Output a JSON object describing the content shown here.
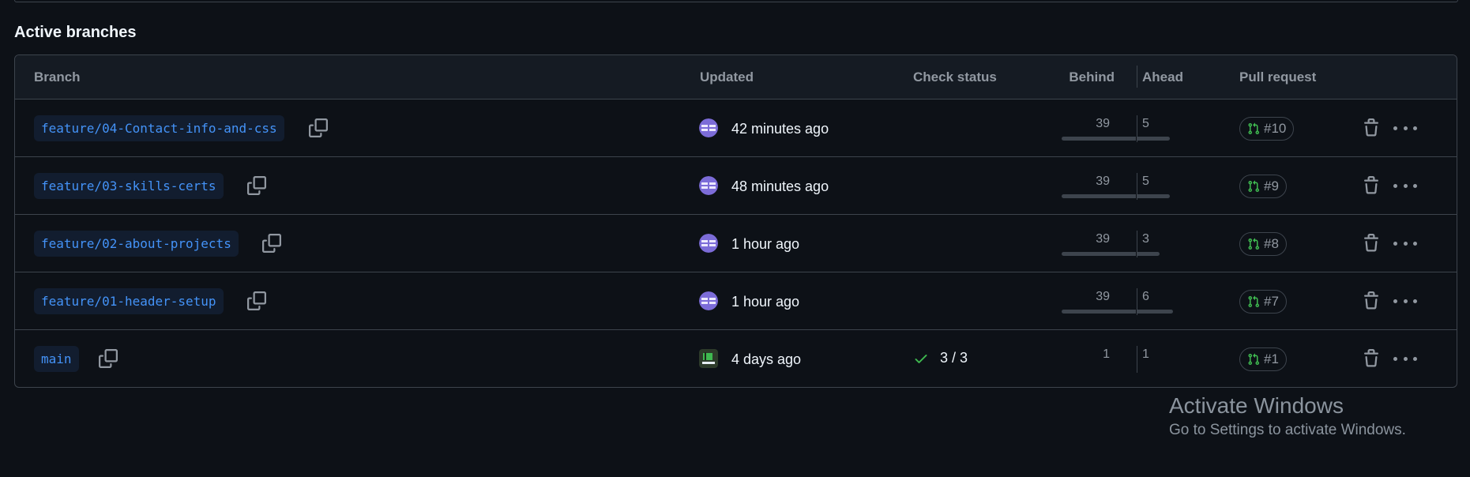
{
  "section_title": "Active branches",
  "headers": {
    "branch": "Branch",
    "updated": "Updated",
    "check_status": "Check status",
    "behind": "Behind",
    "ahead": "Ahead",
    "pull_request": "Pull request"
  },
  "colors": {
    "link_blue": "#4493f8",
    "success_green": "#3fb950",
    "background": "#0d1117",
    "border": "#3d444d"
  },
  "rows": [
    {
      "branch": "feature/04-Contact-info-and-css",
      "updated": "42 minutes ago",
      "check": "",
      "behind": "39",
      "ahead": "5",
      "pr": "#10"
    },
    {
      "branch": "feature/03-skills-certs",
      "updated": "48 minutes ago",
      "check": "",
      "behind": "39",
      "ahead": "5",
      "pr": "#9"
    },
    {
      "branch": "feature/02-about-projects",
      "updated": "1 hour ago",
      "check": "",
      "behind": "39",
      "ahead": "3",
      "pr": "#8"
    },
    {
      "branch": "feature/01-header-setup",
      "updated": "1 hour ago",
      "check": "",
      "behind": "39",
      "ahead": "6",
      "pr": "#7"
    },
    {
      "branch": "main",
      "updated": "4 days ago",
      "check": "3 / 3",
      "behind": "1",
      "ahead": "1",
      "pr": "#1"
    }
  ],
  "icons": {
    "copy": "copy-icon",
    "pull_request": "git-pull-request-icon",
    "check": "check-icon",
    "trash": "trash-icon",
    "more": "kebab-horizontal-icon"
  },
  "watermark": {
    "title": "Activate Windows",
    "subtitle": "Go to Settings to activate Windows."
  }
}
